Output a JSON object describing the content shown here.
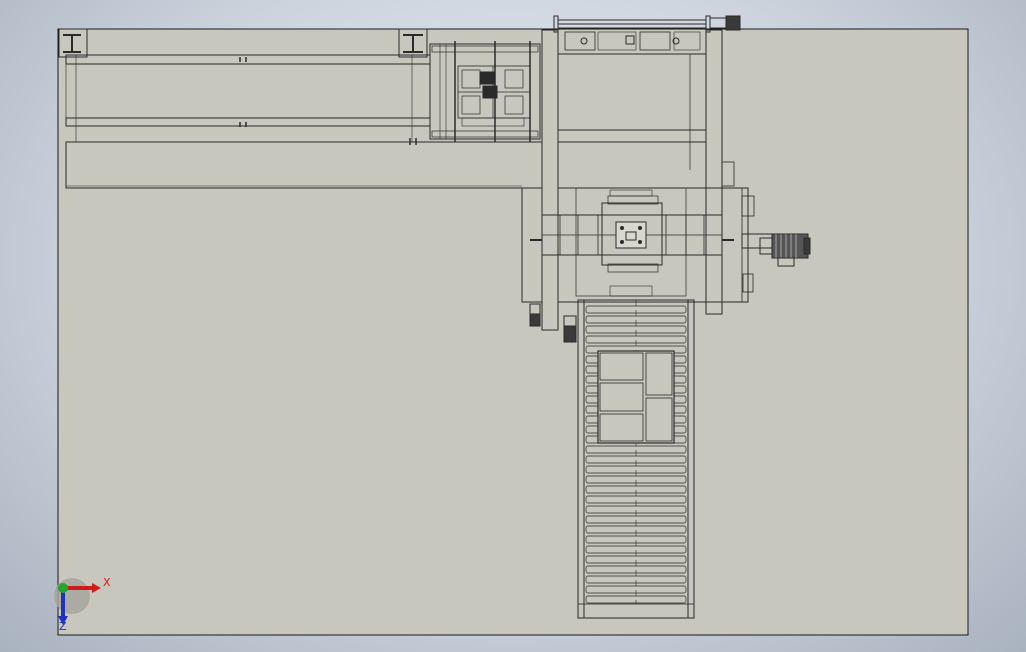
{
  "view": {
    "background": "#c8c7bd",
    "sheet_border": "#1a1a1a",
    "line_color": "#2a2a2a"
  },
  "triad": {
    "x_label": "X",
    "z_label": "Z",
    "x_color": "#d21a1a",
    "y_color": "#1fa82c",
    "z_color": "#2030c0"
  }
}
